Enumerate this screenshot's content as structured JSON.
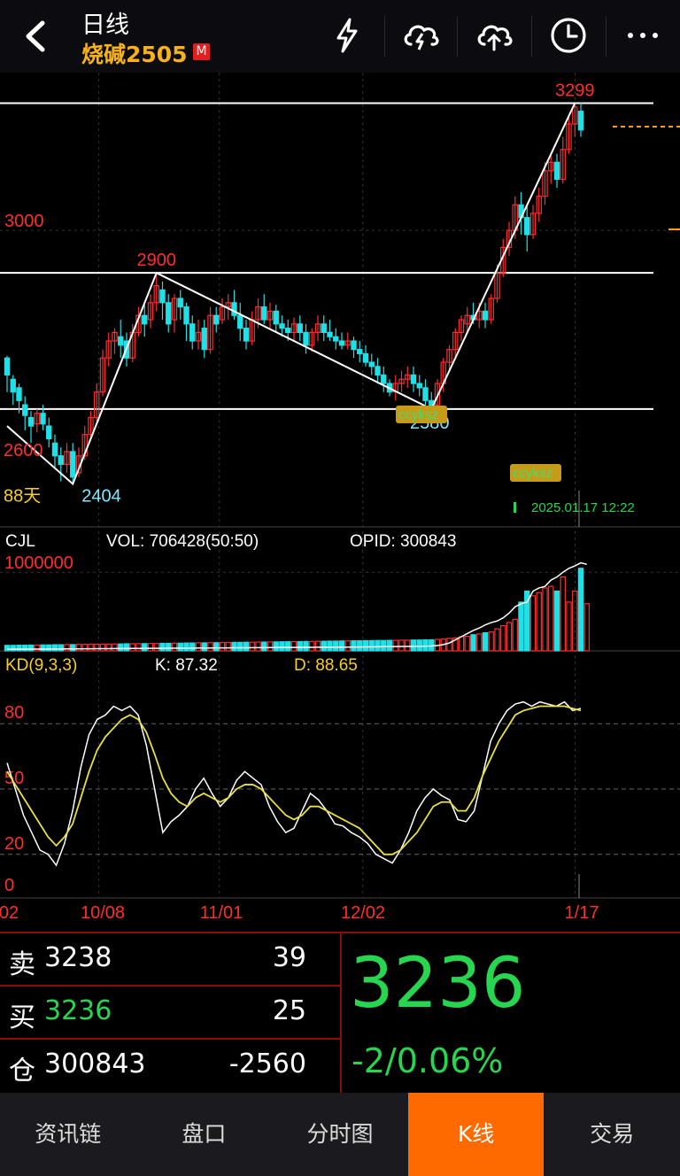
{
  "header": {
    "title": "日线",
    "instrument": "烧碱2505",
    "market_badge": "M",
    "icons": [
      "back-arrow-icon",
      "lightning-icon",
      "cloud-lightning-icon",
      "cloud-upload-icon",
      "clock-icon",
      "more-icon"
    ]
  },
  "chart_data": {
    "type": "candlestick",
    "price_panel": {
      "y_tick": "3000",
      "annotations": {
        "high": "3299",
        "mid_high": "2900",
        "low_mid": "2580",
        "low": "2404",
        "partial_label": "2600",
        "days_label": "88天",
        "tag1": "ccyksz",
        "tag2": "ccyksz",
        "timestamp": "2025.01.17 12:22"
      },
      "support_resistance": [
        3299,
        2900,
        2580
      ],
      "ylim": [
        2330,
        3350
      ],
      "candles": [
        [
          2700,
          2660,
          2705,
          2620
        ],
        [
          2650,
          2620,
          2660,
          2590
        ],
        [
          2630,
          2600,
          2640,
          2570
        ],
        [
          2590,
          2565,
          2610,
          2530
        ],
        [
          2560,
          2540,
          2575,
          2500
        ],
        [
          2545,
          2570,
          2580,
          2525
        ],
        [
          2570,
          2545,
          2590,
          2530
        ],
        [
          2540,
          2510,
          2560,
          2490
        ],
        [
          2500,
          2470,
          2520,
          2440
        ],
        [
          2470,
          2450,
          2490,
          2410
        ],
        [
          2450,
          2480,
          2500,
          2430
        ],
        [
          2480,
          2420,
          2500,
          2404
        ],
        [
          2430,
          2470,
          2490,
          2420
        ],
        [
          2470,
          2520,
          2540,
          2460
        ],
        [
          2520,
          2560,
          2575,
          2505
        ],
        [
          2560,
          2620,
          2640,
          2550
        ],
        [
          2620,
          2700,
          2720,
          2610
        ],
        [
          2700,
          2740,
          2760,
          2680
        ],
        [
          2740,
          2760,
          2770,
          2710
        ],
        [
          2750,
          2730,
          2790,
          2700
        ],
        [
          2740,
          2700,
          2760,
          2680
        ],
        [
          2700,
          2760,
          2780,
          2690
        ],
        [
          2760,
          2800,
          2820,
          2750
        ],
        [
          2800,
          2780,
          2825,
          2750
        ],
        [
          2790,
          2830,
          2850,
          2770
        ],
        [
          2830,
          2870,
          2900,
          2810
        ],
        [
          2860,
          2830,
          2880,
          2790
        ],
        [
          2830,
          2780,
          2850,
          2760
        ],
        [
          2790,
          2840,
          2850,
          2760
        ],
        [
          2840,
          2820,
          2860,
          2790
        ],
        [
          2820,
          2780,
          2830,
          2740
        ],
        [
          2780,
          2740,
          2800,
          2720
        ],
        [
          2740,
          2760,
          2790,
          2720
        ],
        [
          2770,
          2720,
          2790,
          2700
        ],
        [
          2720,
          2800,
          2820,
          2710
        ],
        [
          2800,
          2780,
          2820,
          2760
        ],
        [
          2790,
          2820,
          2840,
          2780
        ],
        [
          2820,
          2830,
          2850,
          2790
        ],
        [
          2830,
          2800,
          2860,
          2790
        ],
        [
          2800,
          2770,
          2830,
          2740
        ],
        [
          2770,
          2740,
          2790,
          2720
        ],
        [
          2740,
          2790,
          2810,
          2730
        ],
        [
          2790,
          2820,
          2840,
          2770
        ],
        [
          2820,
          2790,
          2850,
          2780
        ],
        [
          2790,
          2810,
          2830,
          2770
        ],
        [
          2810,
          2780,
          2825,
          2760
        ],
        [
          2780,
          2770,
          2800,
          2750
        ],
        [
          2770,
          2760,
          2790,
          2740
        ],
        [
          2760,
          2780,
          2795,
          2740
        ],
        [
          2780,
          2760,
          2800,
          2740
        ],
        [
          2760,
          2730,
          2780,
          2710
        ],
        [
          2730,
          2760,
          2770,
          2715
        ],
        [
          2760,
          2780,
          2800,
          2740
        ],
        [
          2780,
          2760,
          2800,
          2740
        ],
        [
          2760,
          2750,
          2790,
          2740
        ],
        [
          2750,
          2740,
          2770,
          2720
        ],
        [
          2740,
          2730,
          2760,
          2720
        ],
        [
          2730,
          2740,
          2760,
          2720
        ],
        [
          2740,
          2720,
          2750,
          2700
        ],
        [
          2720,
          2710,
          2740,
          2690
        ],
        [
          2710,
          2690,
          2730,
          2680
        ],
        [
          2690,
          2680,
          2710,
          2660
        ],
        [
          2680,
          2660,
          2700,
          2640
        ],
        [
          2660,
          2640,
          2680,
          2620
        ],
        [
          2640,
          2620,
          2650,
          2610
        ],
        [
          2620,
          2640,
          2660,
          2600
        ],
        [
          2640,
          2650,
          2670,
          2620
        ],
        [
          2650,
          2660,
          2680,
          2630
        ],
        [
          2660,
          2640,
          2680,
          2620
        ],
        [
          2640,
          2630,
          2660,
          2610
        ],
        [
          2630,
          2600,
          2650,
          2590
        ],
        [
          2600,
          2580,
          2620,
          2575
        ],
        [
          2590,
          2640,
          2650,
          2580
        ],
        [
          2640,
          2690,
          2700,
          2620
        ],
        [
          2690,
          2720,
          2730,
          2670
        ],
        [
          2720,
          2760,
          2770,
          2700
        ],
        [
          2760,
          2790,
          2800,
          2740
        ],
        [
          2780,
          2800,
          2820,
          2760
        ],
        [
          2800,
          2790,
          2830,
          2780
        ],
        [
          2790,
          2810,
          2830,
          2770
        ],
        [
          2810,
          2790,
          2830,
          2770
        ],
        [
          2790,
          2840,
          2850,
          2780
        ],
        [
          2840,
          2900,
          2920,
          2830
        ],
        [
          2900,
          2960,
          2980,
          2890
        ],
        [
          2960,
          3000,
          3020,
          2940
        ],
        [
          3000,
          3060,
          3080,
          2980
        ],
        [
          3060,
          3030,
          3090,
          2990
        ],
        [
          3030,
          2990,
          3060,
          2950
        ],
        [
          2990,
          3040,
          3060,
          2980
        ],
        [
          3040,
          3080,
          3100,
          3020
        ],
        [
          3080,
          3140,
          3160,
          3060
        ],
        [
          3140,
          3160,
          3180,
          3110
        ],
        [
          3160,
          3120,
          3180,
          3100
        ],
        [
          3120,
          3190,
          3220,
          3110
        ],
        [
          3190,
          3250,
          3270,
          3180
        ],
        [
          3250,
          3290,
          3299,
          3220
        ],
        [
          3280,
          3236,
          3300,
          3220
        ]
      ],
      "x_labels": [
        "02",
        "10/08",
        "11/01",
        "12/02",
        "1/17"
      ]
    },
    "volume_panel": {
      "label": "CJL",
      "vol_text": "VOL: 706428(50:50)",
      "opid_text": "OPID: 300843",
      "y_tick": "1000000",
      "ylim": [
        0,
        1250000
      ],
      "bars": [
        70000,
        70000,
        72000,
        72000,
        74000,
        74000,
        76000,
        76000,
        78000,
        78000,
        80000,
        80000,
        82000,
        82000,
        84000,
        84000,
        86000,
        86000,
        88000,
        88000,
        90000,
        90000,
        92000,
        92000,
        94000,
        94000,
        96000,
        96000,
        98000,
        98000,
        100000,
        100000,
        102000,
        102000,
        104000,
        104000,
        106000,
        106000,
        108000,
        108000,
        110000,
        110000,
        112000,
        112000,
        114000,
        114000,
        116000,
        116000,
        118000,
        118000,
        120000,
        120000,
        122000,
        122000,
        124000,
        124000,
        126000,
        126000,
        128000,
        128000,
        130000,
        130000,
        132000,
        132000,
        134000,
        134000,
        136000,
        136000,
        138000,
        138000,
        140000,
        140000,
        145000,
        150000,
        160000,
        165000,
        180000,
        185000,
        205000,
        215000,
        230000,
        240000,
        280000,
        320000,
        360000,
        400000,
        620000,
        760000,
        700000,
        740000,
        800000,
        820000,
        760000,
        940000,
        620000,
        760000,
        1050000,
        600000
      ],
      "oi_line": [
        20000,
        20500,
        21000,
        21500,
        22000,
        22500,
        23000,
        23500,
        24000,
        24500,
        25000,
        25500,
        26000,
        26500,
        27000,
        27500,
        28000,
        28500,
        29000,
        29500,
        30000,
        30500,
        31000,
        31500,
        32000,
        32500,
        33000,
        33500,
        34000,
        34500,
        35000,
        35500,
        36000,
        36500,
        37000,
        37500,
        38000,
        38500,
        39000,
        39500,
        40000,
        40500,
        41000,
        41500,
        42000,
        42500,
        43000,
        43500,
        44000,
        44500,
        45000,
        45500,
        46000,
        46500,
        47000,
        47500,
        48000,
        48500,
        49000,
        49500,
        50000,
        51000,
        52000,
        53000,
        54000,
        55000,
        56000,
        57000,
        58000,
        59000,
        60000,
        62000,
        68000,
        80000,
        100000,
        140000,
        180000,
        220000,
        260000,
        290000,
        330000,
        360000,
        380000,
        420000,
        480000,
        560000,
        600000,
        620000,
        760000,
        800000,
        820000,
        900000,
        940000,
        1000000,
        1050000,
        1080000,
        1120000,
        1100000
      ]
    },
    "kd_panel": {
      "label": "KD(9,3,3)",
      "k_text": "K: 87.32",
      "d_text": "D: 88.65",
      "y_ticks": [
        "80",
        "50",
        "20",
        "0"
      ],
      "ylim": [
        0,
        100
      ],
      "k": [
        62,
        50,
        38,
        30,
        22,
        20,
        15,
        25,
        40,
        60,
        75,
        82,
        84,
        88,
        86,
        88,
        84,
        70,
        50,
        30,
        35,
        38,
        42,
        50,
        55,
        48,
        42,
        46,
        54,
        58,
        55,
        52,
        42,
        35,
        30,
        32,
        40,
        48,
        45,
        40,
        34,
        33,
        30,
        28,
        25,
        20,
        18,
        16,
        22,
        30,
        40,
        46,
        50,
        47,
        45,
        36,
        35,
        40,
        56,
        72,
        80,
        86,
        89,
        90,
        88,
        90,
        89,
        88,
        90,
        86,
        87
      ],
      "d": [
        58,
        52,
        46,
        40,
        34,
        28,
        24,
        28,
        34,
        46,
        58,
        68,
        74,
        78,
        82,
        84,
        82,
        76,
        66,
        55,
        48,
        44,
        42,
        46,
        48,
        46,
        44,
        46,
        50,
        52,
        52,
        50,
        46,
        42,
        38,
        36,
        38,
        42,
        42,
        40,
        38,
        36,
        34,
        32,
        28,
        24,
        20,
        20,
        22,
        26,
        30,
        36,
        42,
        44,
        44,
        40,
        40,
        46,
        56,
        64,
        72,
        78,
        84,
        86,
        87,
        88,
        88,
        88,
        88,
        87,
        86
      ]
    }
  },
  "quote": {
    "sell_label": "卖",
    "sell_price": "3238",
    "sell_qty": "39",
    "buy_label": "买",
    "buy_price": "3236",
    "buy_qty": "25",
    "oi_label": "仓",
    "oi_value": "300843",
    "oi_change": "-2560",
    "last_price": "3236",
    "change": "-2/0.06%",
    "colors": {
      "up": "#ff2d2d",
      "down": "#27d54f",
      "accent": "#ff6a00"
    }
  },
  "nav": {
    "tabs": [
      {
        "label": "资讯链",
        "active": false
      },
      {
        "label": "盘口",
        "active": false
      },
      {
        "label": "分时图",
        "active": false
      },
      {
        "label": "K线",
        "active": true
      },
      {
        "label": "交易",
        "active": false
      }
    ]
  }
}
